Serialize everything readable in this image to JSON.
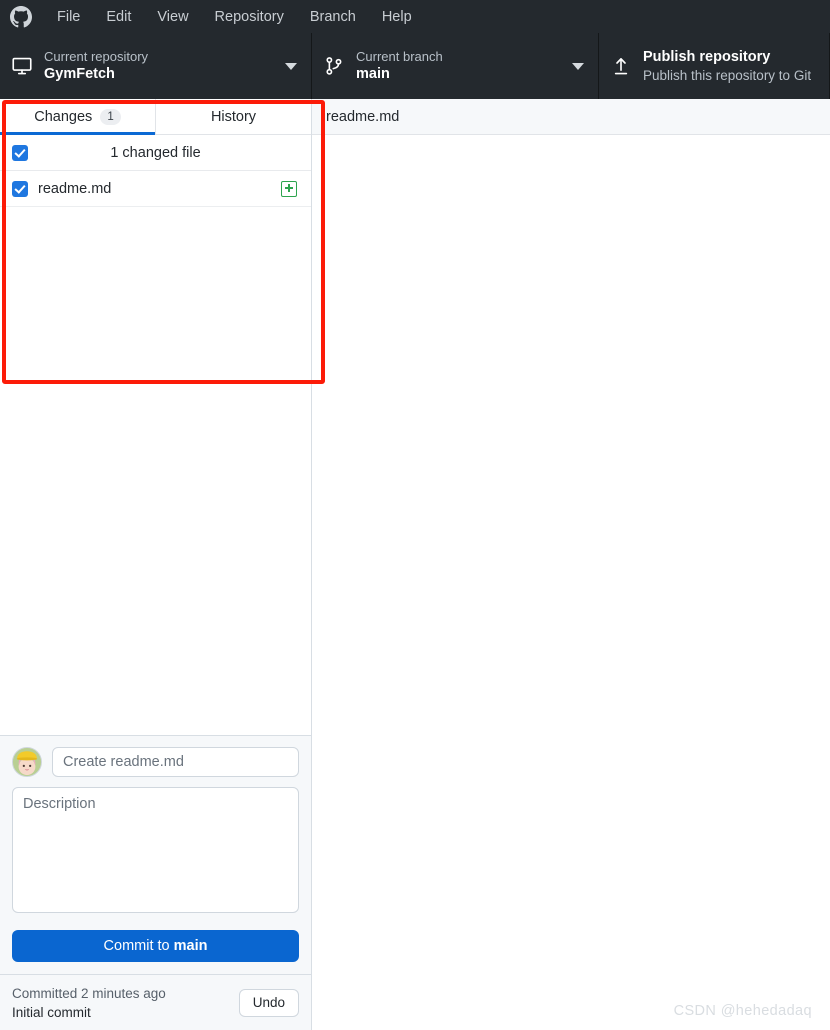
{
  "menu": {
    "logo_icon": "github-logo-icon",
    "items": [
      {
        "label": "File"
      },
      {
        "label": "Edit"
      },
      {
        "label": "View"
      },
      {
        "label": "Repository"
      },
      {
        "label": "Branch"
      },
      {
        "label": "Help"
      }
    ]
  },
  "toolbar": {
    "repository": {
      "icon": "desktop-repo-icon",
      "caption": "Current repository",
      "value": "GymFetch",
      "caret_icon": "chevron-down-icon"
    },
    "branch": {
      "icon": "branch-icon",
      "caption": "Current branch",
      "value": "main",
      "caret_icon": "chevron-down-icon"
    },
    "publish": {
      "icon": "upload-icon",
      "title": "Publish repository",
      "subtitle": "Publish this repository to Git"
    }
  },
  "sidebar": {
    "tabs": [
      {
        "label": "Changes",
        "badge": "1",
        "active": true
      },
      {
        "label": "History",
        "badge": "",
        "active": false
      }
    ],
    "changes_header": {
      "label": "1 changed file",
      "checkbox_icon": "checkbox-checked-icon",
      "checked": true
    },
    "files": [
      {
        "name": "readme.md",
        "checkbox_icon": "checkbox-checked-icon",
        "checked": true,
        "status_icon": "file-added-icon",
        "status": "added"
      }
    ],
    "commit": {
      "avatar_icon": "user-avatar",
      "summary_placeholder": "Create readme.md",
      "summary_value": "",
      "description_placeholder": "Description",
      "description_value": "",
      "button_prefix": "Commit to ",
      "button_branch": "main"
    },
    "footer": {
      "status_line": "Committed 2 minutes ago",
      "commit_title": "Initial commit",
      "undo_label": "Undo"
    }
  },
  "content": {
    "header_title": "readme.md",
    "watermark": "CSDN @hehedadaq"
  },
  "annotation": {
    "color": "#fc1b08",
    "target": "changes-panel"
  },
  "colors": {
    "toolbar_bg": "#24292e",
    "accent_blue": "#0a66d0",
    "added_green": "#2da44e",
    "annotation_red": "#fc1b08"
  }
}
